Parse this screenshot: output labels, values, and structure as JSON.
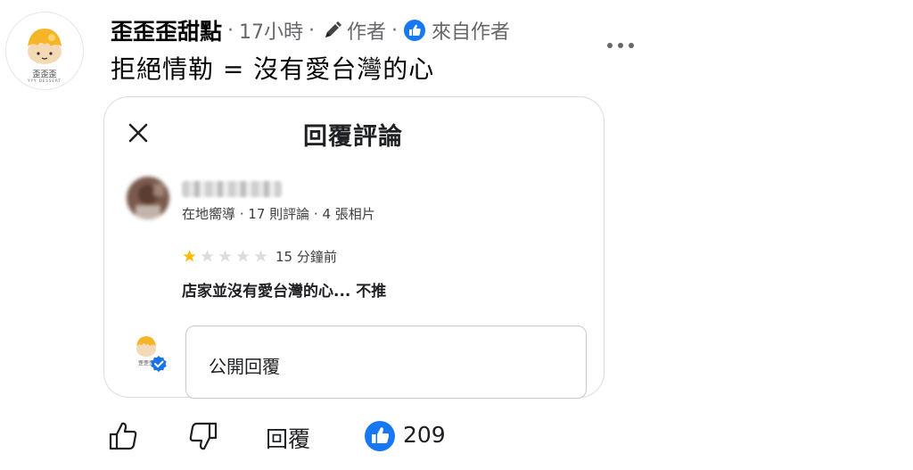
{
  "post": {
    "page_name": "歪歪歪甜點",
    "time": "17小時",
    "author_label": "作者",
    "liked_by_author": "來自作者",
    "text": "拒絕情勒 = 沒有愛台灣的心",
    "avatar_logo_text": "歪歪歪",
    "avatar_logo_subtext": "YYY DESSERT"
  },
  "review_card": {
    "title": "回覆評論",
    "reviewer_meta": "在地嚮導 · 17 則評論 · 4 張相片",
    "rating": 1,
    "max_rating": 5,
    "review_time": "15 分鐘前",
    "review_text": "店家並沒有愛台灣的心... 不推",
    "reply_placeholder": "公開回覆"
  },
  "actions": {
    "reply_label": "回覆",
    "reaction_count": "209"
  },
  "colors": {
    "facebook_blue": "#1877f2",
    "star_gold": "#fbbc04",
    "star_empty": "#dadce0",
    "verified_blue": "#1a73e8",
    "logo_yellow": "#f6b526"
  },
  "icons": [
    "pen-icon",
    "like-icon",
    "more-icon",
    "close-icon",
    "star-icon",
    "verified-icon",
    "thumbs-up-outline-icon",
    "thumbs-down-outline-icon"
  ]
}
